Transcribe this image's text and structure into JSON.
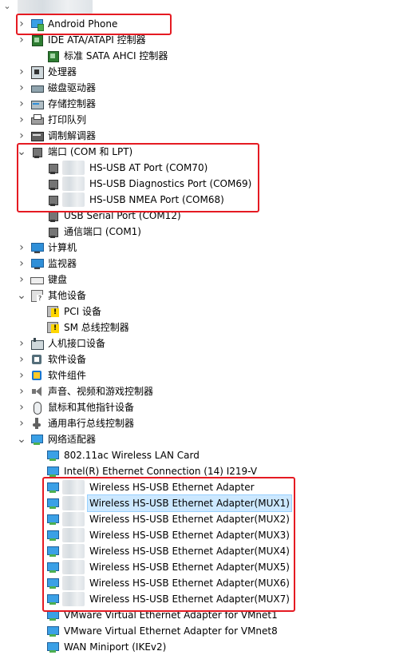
{
  "tree": [
    {
      "id": "android",
      "label": "Android Phone",
      "icon": "phone-icon",
      "chev": ">",
      "blur": 0
    },
    {
      "id": "ide",
      "label": "IDE ATA/ATAPI 控制器",
      "icon": "chip-icon",
      "chev": ">",
      "blur": 0
    },
    {
      "id": "sata",
      "label": "标准 SATA AHCI 控制器",
      "icon": "chip-icon",
      "chev": "",
      "blur": 0
    },
    {
      "id": "cpu",
      "label": "处理器",
      "icon": "cpu-icon",
      "chev": ">",
      "blur": 0
    },
    {
      "id": "disk",
      "label": "磁盘驱动器",
      "icon": "disk-icon",
      "chev": ">",
      "blur": 0
    },
    {
      "id": "storage",
      "label": "存储控制器",
      "icon": "storage-icon",
      "chev": ">",
      "blur": 0
    },
    {
      "id": "print",
      "label": "打印队列",
      "icon": "printer-icon",
      "chev": ">",
      "blur": 0
    },
    {
      "id": "modem",
      "label": "调制解调器",
      "icon": "modem-icon",
      "chev": ">",
      "blur": 0
    },
    {
      "id": "ports",
      "label": "端口 (COM 和 LPT)",
      "icon": "port-icon",
      "chev": "v",
      "blur": 0
    },
    {
      "id": "p70",
      "label": "HS-USB AT Port (COM70)",
      "icon": "port-icon",
      "chev": "",
      "blur": 1
    },
    {
      "id": "p69",
      "label": "HS-USB Diagnostics Port (COM69)",
      "icon": "port-icon",
      "chev": "",
      "blur": 1
    },
    {
      "id": "p68",
      "label": "HS-USB NMEA Port (COM68)",
      "icon": "port-icon",
      "chev": "",
      "blur": 1
    },
    {
      "id": "p12",
      "label": "USB Serial Port (COM12)",
      "icon": "port-icon",
      "chev": "",
      "blur": 0
    },
    {
      "id": "p1",
      "label": "通信端口 (COM1)",
      "icon": "port-icon",
      "chev": "",
      "blur": 0
    },
    {
      "id": "computer",
      "label": "计算机",
      "icon": "monitor-icon",
      "chev": ">",
      "blur": 0
    },
    {
      "id": "display",
      "label": "监视器",
      "icon": "monitor-icon",
      "chev": ">",
      "blur": 0
    },
    {
      "id": "kbd",
      "label": "键盘",
      "icon": "keyboard-icon",
      "chev": ">",
      "blur": 0
    },
    {
      "id": "other",
      "label": "其他设备",
      "icon": "other-device-icon",
      "chev": "v",
      "blur": 0
    },
    {
      "id": "pci",
      "label": "PCI 设备",
      "icon": "warning-icon",
      "chev": "",
      "blur": 0
    },
    {
      "id": "sm",
      "label": "SM 总线控制器",
      "icon": "warning-icon",
      "chev": "",
      "blur": 0
    },
    {
      "id": "hid",
      "label": "人机接口设备",
      "icon": "hid-icon",
      "chev": ">",
      "blur": 0
    },
    {
      "id": "softdev",
      "label": "软件设备",
      "icon": "software-device-icon",
      "chev": ">",
      "blur": 0
    },
    {
      "id": "softcomp",
      "label": "软件组件",
      "icon": "software-component-icon",
      "chev": ">",
      "blur": 0
    },
    {
      "id": "sound",
      "label": "声音、视频和游戏控制器",
      "icon": "speaker-icon",
      "chev": ">",
      "blur": 0
    },
    {
      "id": "mouse",
      "label": "鼠标和其他指针设备",
      "icon": "mouse-icon",
      "chev": ">",
      "blur": 0
    },
    {
      "id": "usb",
      "label": "通用串行总线控制器",
      "icon": "usb-icon",
      "chev": ">",
      "blur": 0
    },
    {
      "id": "net",
      "label": "网络适配器",
      "icon": "network-icon",
      "chev": "v",
      "blur": 0
    },
    {
      "id": "wlan",
      "label": "802.11ac Wireless LAN Card",
      "icon": "network-icon",
      "chev": "",
      "blur": 0
    },
    {
      "id": "eth",
      "label": "Intel(R) Ethernet Connection (14) I219-V",
      "icon": "network-icon",
      "chev": "",
      "blur": 0
    },
    {
      "id": "m0",
      "label": "Wireless HS-USB Ethernet Adapter",
      "icon": "network-icon",
      "chev": "",
      "blur": 1
    },
    {
      "id": "m1",
      "label": "Wireless HS-USB Ethernet Adapter(MUX1)",
      "icon": "network-icon",
      "chev": "",
      "blur": 1,
      "selected": true
    },
    {
      "id": "m2",
      "label": "Wireless HS-USB Ethernet Adapter(MUX2)",
      "icon": "network-icon",
      "chev": "",
      "blur": 1
    },
    {
      "id": "m3",
      "label": "Wireless HS-USB Ethernet Adapter(MUX3)",
      "icon": "network-icon",
      "chev": "",
      "blur": 1
    },
    {
      "id": "m4",
      "label": "Wireless HS-USB Ethernet Adapter(MUX4)",
      "icon": "network-icon",
      "chev": "",
      "blur": 1
    },
    {
      "id": "m5",
      "label": "Wireless HS-USB Ethernet Adapter(MUX5)",
      "icon": "network-icon",
      "chev": "",
      "blur": 1
    },
    {
      "id": "m6",
      "label": "Wireless HS-USB Ethernet Adapter(MUX6)",
      "icon": "network-icon",
      "chev": "",
      "blur": 1
    },
    {
      "id": "m7",
      "label": "Wireless HS-USB Ethernet Adapter(MUX7)",
      "icon": "network-icon",
      "chev": "",
      "blur": 1
    },
    {
      "id": "vm1",
      "label": "VMware Virtual Ethernet Adapter for VMnet1",
      "icon": "network-icon",
      "chev": "",
      "blur": 0
    },
    {
      "id": "vm8",
      "label": "VMware Virtual Ethernet Adapter for VMnet8",
      "icon": "network-icon",
      "chev": "",
      "blur": 0
    },
    {
      "id": "wan",
      "label": "WAN Miniport (IKEv2)",
      "icon": "network-icon",
      "chev": "",
      "blur": 0
    }
  ],
  "colors": {
    "highlight_box": "#e51a22",
    "selection": "#cce8ff"
  }
}
